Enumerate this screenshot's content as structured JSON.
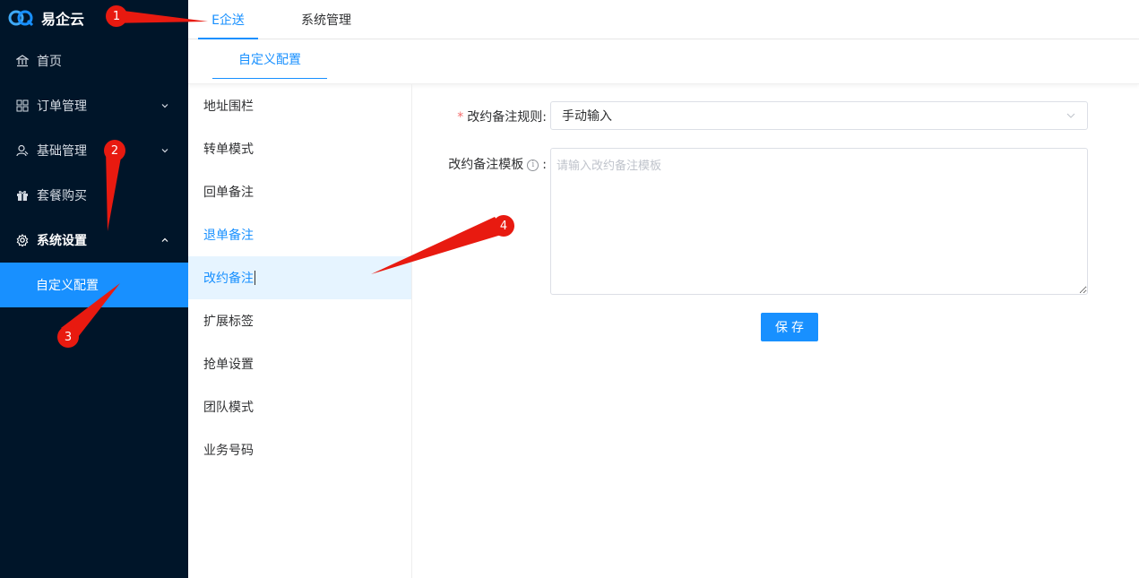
{
  "app": {
    "name": "易企云"
  },
  "sidebar": {
    "items": [
      {
        "label": "首页",
        "icon": "bank-icon"
      },
      {
        "label": "订单管理",
        "icon": "grid-icon"
      },
      {
        "label": "基础管理",
        "icon": "user-icon"
      },
      {
        "label": "套餐购买",
        "icon": "gift-icon"
      },
      {
        "label": "系统设置",
        "icon": "gear-icon"
      }
    ],
    "subitem": {
      "label": "自定义配置"
    }
  },
  "header": {
    "tabs": [
      {
        "label": "E企送"
      },
      {
        "label": "系统管理"
      }
    ]
  },
  "subheader": {
    "tab": "自定义配置"
  },
  "settings": {
    "items": [
      {
        "label": "地址围栏"
      },
      {
        "label": "转单模式"
      },
      {
        "label": "回单备注"
      },
      {
        "label": "退单备注"
      },
      {
        "label": "改约备注"
      },
      {
        "label": "扩展标签"
      },
      {
        "label": "抢单设置"
      },
      {
        "label": "团队模式"
      },
      {
        "label": "业务号码"
      }
    ]
  },
  "form": {
    "rule_label": "改约备注规则:",
    "rule_value": "手动输入",
    "template_label": "改约备注模板",
    "template_colon": ":",
    "template_placeholder": "请输入改约备注模板",
    "save_label": "保存"
  },
  "annotations": [
    "1",
    "2",
    "3",
    "4"
  ],
  "colors": {
    "sidebar_bg": "#001529",
    "accent": "#1890ff",
    "annotation": "#e81a10"
  }
}
